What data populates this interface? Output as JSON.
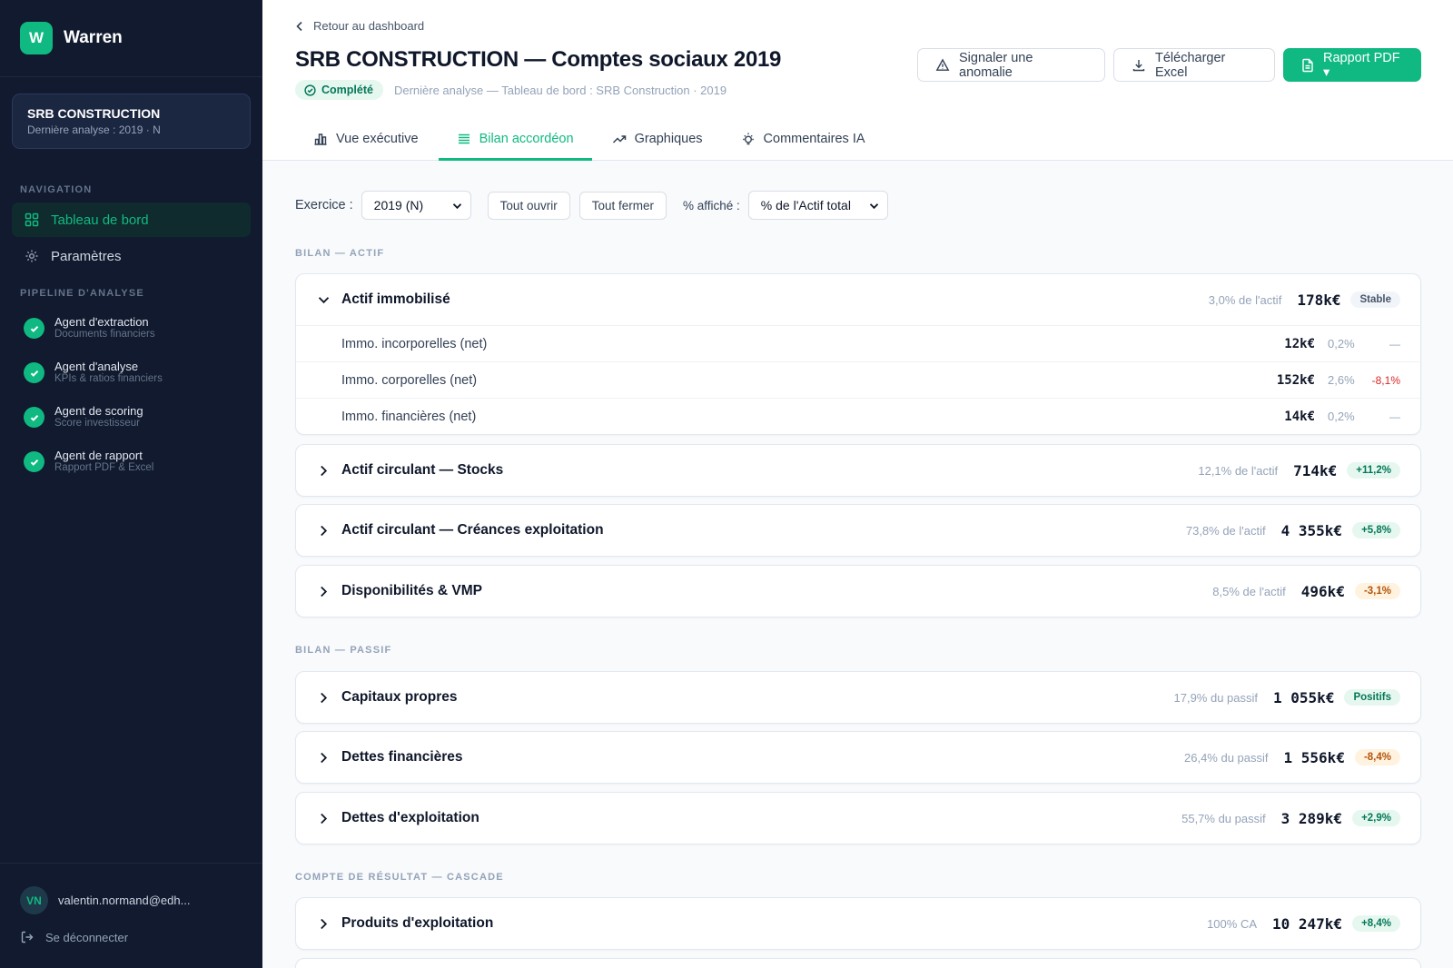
{
  "brand": {
    "logo_letter": "W",
    "name": "Warren"
  },
  "company": {
    "name": "SRB CONSTRUCTION",
    "subtitle": "Dernière analyse : 2019 · N"
  },
  "sidebar": {
    "nav_label": "NAVIGATION",
    "nav": [
      {
        "label": "Tableau de bord",
        "icon": "dashboard-icon",
        "active": true
      },
      {
        "label": "Paramètres",
        "icon": "gear-icon",
        "active": false
      }
    ],
    "pipeline_label": "PIPELINE D'ANALYSE",
    "agents": [
      {
        "title": "Agent d'extraction",
        "subtitle": "Documents financiers"
      },
      {
        "title": "Agent d'analyse",
        "subtitle": "KPIs & ratios financiers"
      },
      {
        "title": "Agent de scoring",
        "subtitle": "Score investisseur"
      },
      {
        "title": "Agent de rapport",
        "subtitle": "Rapport PDF & Excel"
      }
    ],
    "user": {
      "initials": "VN",
      "email": "valentin.normand@edh..."
    },
    "logout_label": "Se déconnecter"
  },
  "header": {
    "back_label": "Retour au dashboard",
    "title": "SRB CONSTRUCTION — Comptes sociaux 2019",
    "status": "Complété",
    "meta": "Dernière analyse — Tableau de bord : SRB Construction · 2019",
    "buttons": {
      "anomaly": "Signaler une anomalie",
      "excel": "Télécharger Excel",
      "pdf": "Rapport PDF ▾"
    },
    "tabs": [
      {
        "label": "Vue exécutive",
        "icon": "bar-chart-icon"
      },
      {
        "label": "Bilan accordéon",
        "icon": "list-icon"
      },
      {
        "label": "Graphiques",
        "icon": "trend-icon"
      },
      {
        "label": "Commentaires IA",
        "icon": "lightbulb-icon"
      }
    ]
  },
  "toolbar": {
    "exercise_label": "Exercice :",
    "exercise_value": "2019 (N)",
    "open_all": "Tout ouvrir",
    "close_all": "Tout fermer",
    "pct_label": "% affiché :",
    "pct_value": "% de l'Actif total"
  },
  "sections": {
    "actif_label": "BILAN — ACTIF",
    "passif_label": "BILAN — PASSIF",
    "result_label": "COMPTE DE RÉSULTAT — CASCADE"
  },
  "actif": {
    "immobilise": {
      "title": "Actif immobilisé",
      "pct": "3,0% de l'actif",
      "value": "178k€",
      "badge": "Stable",
      "rows": [
        {
          "label": "Immo. incorporelles (net)",
          "value": "12k€",
          "pct": "0,2%",
          "delta": "—"
        },
        {
          "label": "Immo. corporelles (net)",
          "value": "152k€",
          "pct": "2,6%",
          "delta": "-8,1%"
        },
        {
          "label": "Immo. financières (net)",
          "value": "14k€",
          "pct": "0,2%",
          "delta": "—"
        }
      ]
    },
    "stocks": {
      "title": "Actif circulant — Stocks",
      "pct": "12,1% de l'actif",
      "value": "714k€",
      "badge": "+11,2%"
    },
    "creances": {
      "title": "Actif circulant — Créances exploitation",
      "pct": "73,8% de l'actif",
      "value": "4 355k€",
      "badge": "+5,8%"
    },
    "dispo": {
      "title": "Disponibilités & VMP",
      "pct": "8,5% de l'actif",
      "value": "496k€",
      "badge": "-3,1%"
    }
  },
  "passif": {
    "capitaux": {
      "title": "Capitaux propres",
      "pct": "17,9% du passif",
      "value": "1 055k€",
      "badge": "Positifs"
    },
    "dettes_fin": {
      "title": "Dettes financières",
      "pct": "26,4% du passif",
      "value": "1 556k€",
      "badge": "-8,4%"
    },
    "dettes_exp": {
      "title": "Dettes d'exploitation",
      "pct": "55,7% du passif",
      "value": "3 289k€",
      "badge": "+2,9%"
    }
  },
  "resultat": {
    "produits": {
      "title": "Produits d'exploitation",
      "pct": "100% CA",
      "value": "10 247k€",
      "badge": "+8,4%"
    }
  },
  "colors": {
    "accent": "#10b981",
    "sidebar_bg": "#111a2e",
    "negative": "#dc2626",
    "warning": "#b45309"
  }
}
